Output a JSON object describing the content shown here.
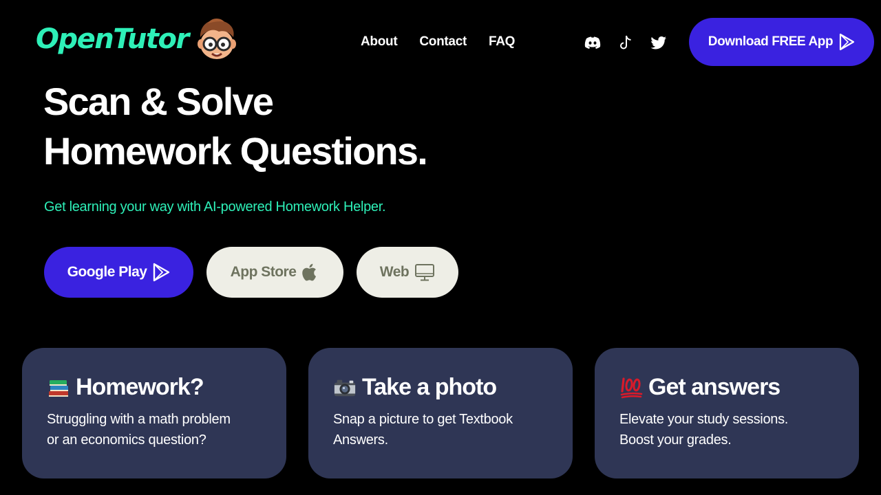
{
  "brand": {
    "name": "OpenTutor"
  },
  "nav": {
    "items": [
      "About",
      "Contact",
      "FAQ"
    ]
  },
  "socials": [
    "discord-icon",
    "tiktok-icon",
    "twitter-icon"
  ],
  "cta": {
    "label": "Download FREE App",
    "icon": "play-triangle-icon"
  },
  "hero": {
    "title_line1": "Scan & Solve",
    "title_line2": "Homework Questions.",
    "subtitle": "Get learning your way with AI-powered Homework Helper."
  },
  "stores": {
    "google_play": {
      "label": "Google Play",
      "icon": "play-triangle-icon"
    },
    "app_store": {
      "label": "App Store",
      "icon": "apple-icon"
    },
    "web": {
      "label": "Web",
      "icon": "monitor-icon"
    }
  },
  "cards": [
    {
      "emoji": "books-icon",
      "title": "Homework?",
      "text_line1": "Struggling with a math problem",
      "text_line2": "or an economics question?"
    },
    {
      "emoji": "camera-icon",
      "title": "Take a photo",
      "text_line1": "Snap a picture to get Textbook",
      "text_line2": "Answers."
    },
    {
      "emoji": "hundred-points-icon",
      "title": "Get answers",
      "text_line1": "Elevate your study sessions.",
      "text_line2": "Boost your grades."
    }
  ],
  "colors": {
    "background": "#000000",
    "brand_accent": "#2ef0b8",
    "primary_button": "#3a22e0",
    "secondary_button": "#eeeee6",
    "card_background": "#2f3655"
  }
}
